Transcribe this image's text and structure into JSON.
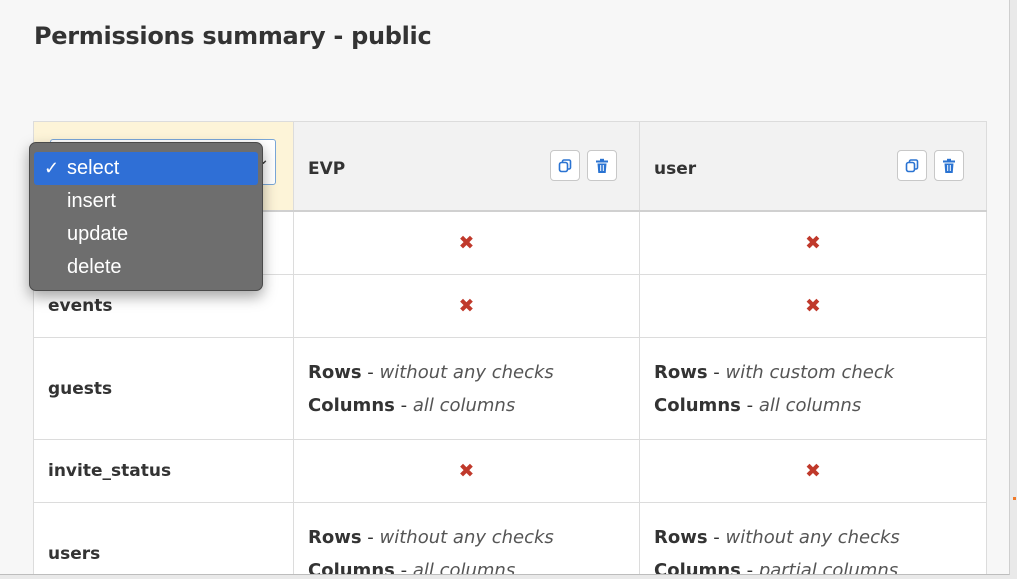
{
  "page_title": "Permissions summary - public",
  "action_dropdown": {
    "selected": "select",
    "options": [
      {
        "label": "select",
        "checked": "✓"
      },
      {
        "label": "insert",
        "checked": ""
      },
      {
        "label": "update",
        "checked": ""
      },
      {
        "label": "delete",
        "checked": ""
      }
    ]
  },
  "roles": [
    {
      "name": "EVP",
      "copy_icon": "copy-icon",
      "delete_icon": "trash-icon"
    },
    {
      "name": "user",
      "copy_icon": "copy-icon",
      "delete_icon": "trash-icon"
    }
  ],
  "rows": [
    {
      "table": "",
      "cells": [
        {
          "type": "none",
          "mark": "✖"
        },
        {
          "type": "none",
          "mark": "✖"
        }
      ]
    },
    {
      "table": "events",
      "cells": [
        {
          "type": "none",
          "mark": "✖"
        },
        {
          "type": "none",
          "mark": "✖"
        }
      ]
    },
    {
      "table": "guests",
      "cells": [
        {
          "type": "perm",
          "rows_label": "Rows",
          "rows_value": "without any checks",
          "cols_label": "Columns",
          "cols_value": "all columns"
        },
        {
          "type": "perm",
          "rows_label": "Rows",
          "rows_value": "with custom check",
          "cols_label": "Columns",
          "cols_value": "all columns"
        }
      ]
    },
    {
      "table": "invite_status",
      "cells": [
        {
          "type": "none",
          "mark": "✖"
        },
        {
          "type": "none",
          "mark": "✖"
        }
      ]
    },
    {
      "table": "users",
      "cells": [
        {
          "type": "perm",
          "rows_label": "Rows",
          "rows_value": "without any checks",
          "cols_label": "Columns",
          "cols_value": "all columns"
        },
        {
          "type": "perm",
          "rows_label": "Rows",
          "rows_value": "without any checks",
          "cols_label": "Columns",
          "cols_value": "partial columns"
        }
      ]
    }
  ],
  "separator": " - ",
  "colors": {
    "deny_mark": "#c0392b",
    "dropdown_bg": "#6e6e6e",
    "dropdown_selected": "#2f6fd6",
    "select_cell_bg": "#fdf4d8",
    "icon_blue": "#2a73d2"
  }
}
